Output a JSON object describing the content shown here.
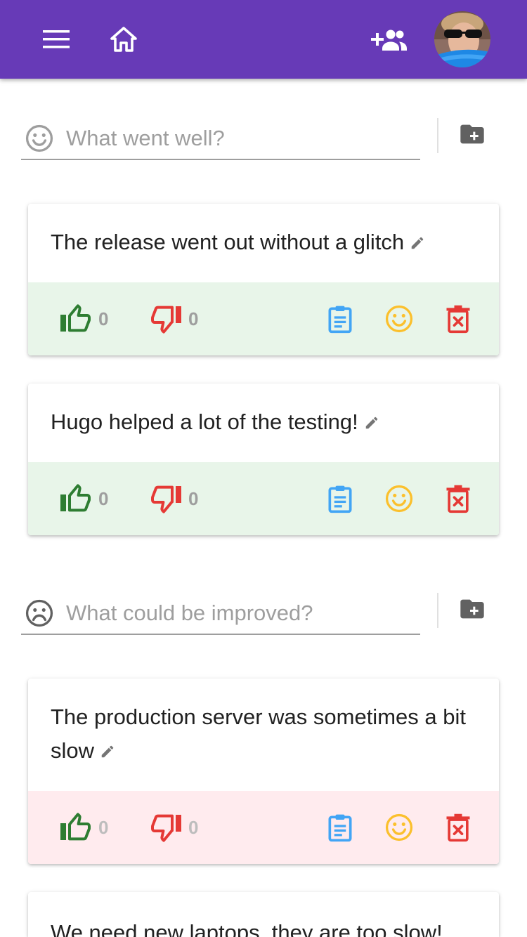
{
  "colors": {
    "appbar": "#673ab7",
    "like": "#2e7d32",
    "dislike": "#e53935",
    "copy": "#42a5f5",
    "react": "#fbc02d",
    "delete": "#e53935",
    "good_card_footer": "#e8f5e9",
    "bad_card_footer": "#ffebee"
  },
  "header": {
    "menu_icon": "menu-icon",
    "home_icon": "home-icon",
    "invite_icon": "group-add-icon",
    "avatar": "user-avatar"
  },
  "sections": [
    {
      "mood_icon": "smile-face-icon",
      "placeholder": "What went well?",
      "value": "",
      "add_icon": "create-new-folder-icon",
      "cards": [
        {
          "text": "The release went out without a glitch",
          "likes": "0",
          "dislikes": "0"
        },
        {
          "text": "Hugo helped a lot of the testing!",
          "likes": "0",
          "dislikes": "0"
        }
      ]
    },
    {
      "mood_icon": "sad-face-icon",
      "placeholder": "What could be improved?",
      "value": "",
      "add_icon": "create-new-folder-icon",
      "cards": [
        {
          "text": "The production server was sometimes a bit slow",
          "likes": "0",
          "dislikes": "0"
        },
        {
          "text": "We need new laptops, they are too slow!",
          "likes": "",
          "dislikes": ""
        }
      ]
    }
  ]
}
